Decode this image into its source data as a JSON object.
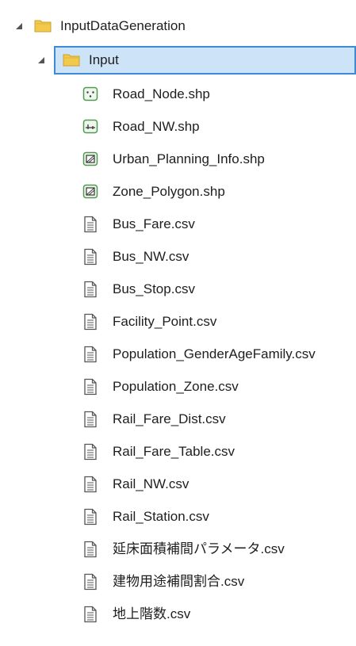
{
  "tree": {
    "root": {
      "label": "InputDataGeneration",
      "icon": "folder-icon",
      "expanded": true
    },
    "input_folder": {
      "label": "Input",
      "icon": "folder-icon",
      "expanded": true,
      "selected": true
    },
    "items": [
      {
        "label": "Road_Node.shp",
        "icon": "point-layer-icon"
      },
      {
        "label": "Road_NW.shp",
        "icon": "line-layer-icon"
      },
      {
        "label": "Urban_Planning_Info.shp",
        "icon": "polygon-layer-icon"
      },
      {
        "label": "Zone_Polygon.shp",
        "icon": "polygon-layer-icon"
      },
      {
        "label": "Bus_Fare.csv",
        "icon": "text-file-icon"
      },
      {
        "label": "Bus_NW.csv",
        "icon": "text-file-icon"
      },
      {
        "label": "Bus_Stop.csv",
        "icon": "text-file-icon"
      },
      {
        "label": "Facility_Point.csv",
        "icon": "text-file-icon"
      },
      {
        "label": "Population_GenderAgeFamily.csv",
        "icon": "text-file-icon"
      },
      {
        "label": "Population_Zone.csv",
        "icon": "text-file-icon"
      },
      {
        "label": "Rail_Fare_Dist.csv",
        "icon": "text-file-icon"
      },
      {
        "label": "Rail_Fare_Table.csv",
        "icon": "text-file-icon"
      },
      {
        "label": "Rail_NW.csv",
        "icon": "text-file-icon"
      },
      {
        "label": "Rail_Station.csv",
        "icon": "text-file-icon"
      },
      {
        "label": "延床面積補間パラメータ.csv",
        "icon": "text-file-icon"
      },
      {
        "label": "建物用途補間割合.csv",
        "icon": "text-file-icon"
      },
      {
        "label": "地上階数.csv",
        "icon": "text-file-icon"
      }
    ]
  },
  "colors": {
    "selection_fill": "#cde3f7",
    "selection_border": "#3c8ad8",
    "folder": "#f2c94c",
    "layer_icon_green": "#4e9a4e",
    "doc_icon": "#555555"
  }
}
